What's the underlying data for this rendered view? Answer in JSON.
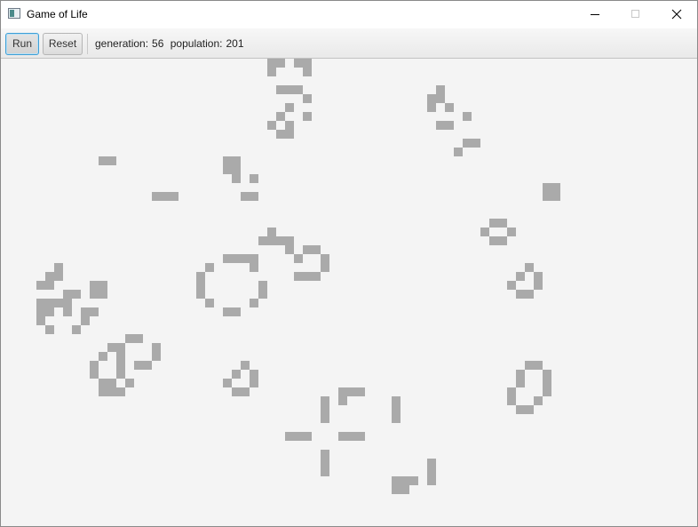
{
  "window": {
    "title": "Game of Life"
  },
  "toolbar": {
    "run_label": "Run",
    "reset_label": "Reset",
    "generation_label": "generation:",
    "generation_value": "56",
    "population_label": "population:",
    "population_value": "201"
  },
  "board": {
    "live_cell_color": "#aaaaaa",
    "background_color": "#f4f4f4",
    "live_cells": [
      [
        30,
        0
      ],
      [
        31,
        0
      ],
      [
        33,
        0
      ],
      [
        34,
        0
      ],
      [
        30,
        1
      ],
      [
        34,
        1
      ],
      [
        31,
        3
      ],
      [
        32,
        3
      ],
      [
        33,
        3
      ],
      [
        34,
        4
      ],
      [
        32,
        5
      ],
      [
        34,
        6
      ],
      [
        31,
        6
      ],
      [
        30,
        7
      ],
      [
        32,
        7
      ],
      [
        31,
        8
      ],
      [
        32,
        8
      ],
      [
        49,
        3
      ],
      [
        48,
        4
      ],
      [
        49,
        4
      ],
      [
        48,
        5
      ],
      [
        50,
        5
      ],
      [
        52,
        6
      ],
      [
        49,
        7
      ],
      [
        50,
        7
      ],
      [
        52,
        9
      ],
      [
        53,
        9
      ],
      [
        51,
        10
      ],
      [
        11,
        11
      ],
      [
        12,
        11
      ],
      [
        25,
        11
      ],
      [
        26,
        11
      ],
      [
        25,
        12
      ],
      [
        26,
        12
      ],
      [
        26,
        13
      ],
      [
        28,
        13
      ],
      [
        61,
        14
      ],
      [
        62,
        14
      ],
      [
        61,
        15
      ],
      [
        62,
        15
      ],
      [
        17,
        15
      ],
      [
        18,
        15
      ],
      [
        19,
        15
      ],
      [
        27,
        15
      ],
      [
        28,
        15
      ],
      [
        55,
        18
      ],
      [
        56,
        18
      ],
      [
        54,
        19
      ],
      [
        57,
        19
      ],
      [
        55,
        20
      ],
      [
        56,
        20
      ],
      [
        30,
        19
      ],
      [
        29,
        20
      ],
      [
        30,
        20
      ],
      [
        31,
        20
      ],
      [
        32,
        20
      ],
      [
        32,
        21
      ],
      [
        34,
        21
      ],
      [
        35,
        21
      ],
      [
        33,
        22
      ],
      [
        36,
        22
      ],
      [
        36,
        23
      ],
      [
        33,
        24
      ],
      [
        34,
        24
      ],
      [
        35,
        24
      ],
      [
        25,
        22
      ],
      [
        26,
        22
      ],
      [
        27,
        22
      ],
      [
        28,
        22
      ],
      [
        23,
        23
      ],
      [
        28,
        23
      ],
      [
        22,
        24
      ],
      [
        22,
        25
      ],
      [
        29,
        25
      ],
      [
        22,
        26
      ],
      [
        29,
        26
      ],
      [
        23,
        27
      ],
      [
        28,
        27
      ],
      [
        25,
        28
      ],
      [
        26,
        28
      ],
      [
        6,
        23
      ],
      [
        5,
        24
      ],
      [
        6,
        24
      ],
      [
        4,
        25
      ],
      [
        5,
        25
      ],
      [
        7,
        26
      ],
      [
        8,
        26
      ],
      [
        10,
        25
      ],
      [
        11,
        25
      ],
      [
        10,
        26
      ],
      [
        11,
        26
      ],
      [
        4,
        27
      ],
      [
        5,
        27
      ],
      [
        6,
        27
      ],
      [
        7,
        27
      ],
      [
        4,
        28
      ],
      [
        5,
        28
      ],
      [
        7,
        28
      ],
      [
        9,
        28
      ],
      [
        10,
        28
      ],
      [
        4,
        29
      ],
      [
        9,
        29
      ],
      [
        5,
        30
      ],
      [
        8,
        30
      ],
      [
        59,
        23
      ],
      [
        58,
        24
      ],
      [
        60,
        24
      ],
      [
        57,
        25
      ],
      [
        60,
        25
      ],
      [
        58,
        26
      ],
      [
        59,
        26
      ],
      [
        14,
        31
      ],
      [
        15,
        31
      ],
      [
        12,
        32
      ],
      [
        13,
        32
      ],
      [
        17,
        32
      ],
      [
        11,
        33
      ],
      [
        13,
        33
      ],
      [
        17,
        33
      ],
      [
        10,
        34
      ],
      [
        13,
        34
      ],
      [
        15,
        34
      ],
      [
        16,
        34
      ],
      [
        10,
        35
      ],
      [
        13,
        35
      ],
      [
        11,
        36
      ],
      [
        12,
        36
      ],
      [
        14,
        36
      ],
      [
        11,
        37
      ],
      [
        12,
        37
      ],
      [
        13,
        37
      ],
      [
        27,
        34
      ],
      [
        26,
        35
      ],
      [
        28,
        35
      ],
      [
        25,
        36
      ],
      [
        28,
        36
      ],
      [
        26,
        37
      ],
      [
        27,
        37
      ],
      [
        59,
        34
      ],
      [
        60,
        34
      ],
      [
        58,
        35
      ],
      [
        61,
        35
      ],
      [
        58,
        36
      ],
      [
        61,
        36
      ],
      [
        57,
        37
      ],
      [
        61,
        37
      ],
      [
        57,
        38
      ],
      [
        60,
        38
      ],
      [
        58,
        39
      ],
      [
        59,
        39
      ],
      [
        38,
        37
      ],
      [
        39,
        37
      ],
      [
        40,
        37
      ],
      [
        38,
        38
      ],
      [
        36,
        38
      ],
      [
        36,
        39
      ],
      [
        44,
        38
      ],
      [
        44,
        39
      ],
      [
        36,
        40
      ],
      [
        44,
        40
      ],
      [
        32,
        42
      ],
      [
        33,
        42
      ],
      [
        34,
        42
      ],
      [
        38,
        42
      ],
      [
        39,
        42
      ],
      [
        40,
        42
      ],
      [
        36,
        44
      ],
      [
        36,
        45
      ],
      [
        36,
        46
      ],
      [
        48,
        45
      ],
      [
        48,
        46
      ],
      [
        45,
        47
      ],
      [
        46,
        47
      ],
      [
        48,
        47
      ],
      [
        44,
        47
      ],
      [
        44,
        48
      ],
      [
        45,
        48
      ]
    ]
  }
}
